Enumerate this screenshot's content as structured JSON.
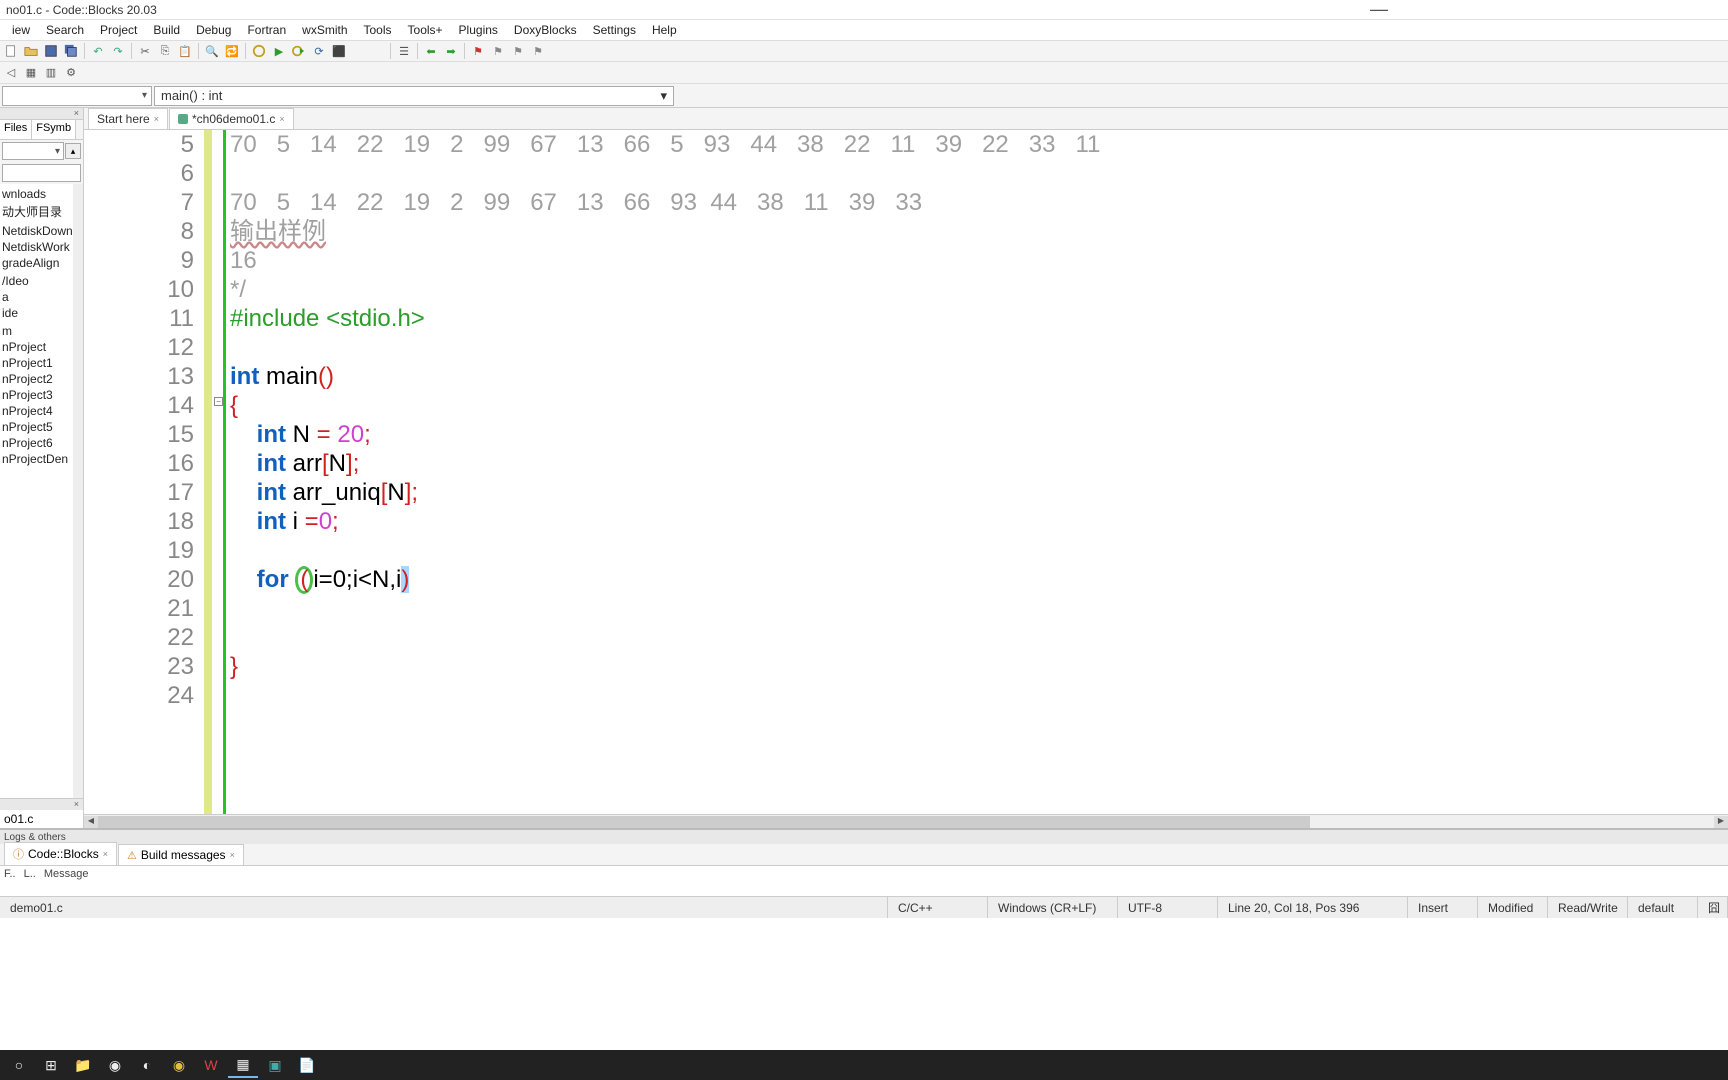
{
  "window": {
    "title": "no01.c - Code::Blocks 20.03"
  },
  "menu": [
    "iew",
    "Search",
    "Project",
    "Build",
    "Debug",
    "Fortran",
    "wxSmith",
    "Tools",
    "Tools+",
    "Plugins",
    "DoxyBlocks",
    "Settings",
    "Help"
  ],
  "scope": {
    "func": "main() : int"
  },
  "sidebar": {
    "tabs": [
      "Files",
      "FSymb"
    ],
    "tree": [
      "wnloads",
      "动大师目录",
      "",
      "NetdiskDown",
      "NetdiskWork",
      "gradeAlign",
      "",
      "/Ideo",
      "a",
      "ide",
      "",
      "m",
      "nProject",
      "nProject1",
      "nProject2",
      "nProject3",
      "nProject4",
      "nProject5",
      "nProject6",
      "nProjectDen"
    ],
    "bottomfile": "o01.c"
  },
  "editor": {
    "tabs": [
      {
        "label": "Start here",
        "close": "×"
      },
      {
        "label": "*ch06demo01.c",
        "close": "×"
      }
    ],
    "lines": {
      "5": "70   5   14   22   19   2   99   67   13   66   5   93   44   38   22   11   39   22   33   11",
      "6": "",
      "7": "70   5   14   22   19   2   99   67   13   66   93  44   38   11   39   33",
      "8": "输出样例",
      "9": "16",
      "10": "*/",
      "11_pp": "#include <stdio.h>",
      "13_kw1": "int",
      "13_id": " main",
      "13_par": "()",
      "14_brace": "{",
      "15_kw": "int",
      "15_id": " N ",
      "15_op": "=",
      "15_num": " 20",
      "15_semi": ";",
      "16_kw": "int",
      "16_id": " arr",
      "16_br1": "[",
      "16_idx": "N",
      "16_br2": "]",
      "16_semi": ";",
      "17_kw": "int",
      "17_id": " arr_uniq",
      "17_br1": "[",
      "17_idx": "N",
      "17_br2": "]",
      "17_semi": ";",
      "18_kw": "int",
      "18_id": " i ",
      "18_op": "=",
      "18_num": "0",
      "18_semi": ";",
      "20_kw": "for",
      "20_sp": " ",
      "20_p1": "(",
      "20_body": "i=0;i<N,i",
      "20_p2": ")",
      "23_brace": "}"
    },
    "line_numbers": [
      5,
      6,
      7,
      8,
      9,
      10,
      11,
      12,
      13,
      14,
      15,
      16,
      17,
      18,
      19,
      20,
      21,
      22,
      23,
      24
    ]
  },
  "logs": {
    "title": "Logs & others",
    "tabs": [
      {
        "label": "Code::Blocks"
      },
      {
        "label": "Build messages"
      }
    ],
    "cols": [
      "F..",
      "L..",
      "Message"
    ]
  },
  "status": {
    "file": "demo01.c",
    "lang": "C/C++",
    "eol": "Windows (CR+LF)",
    "enc": "UTF-8",
    "pos": "Line 20, Col 18, Pos 396",
    "ins": "Insert",
    "mod": "Modified",
    "rw": "Read/Write",
    "prof": "default"
  }
}
